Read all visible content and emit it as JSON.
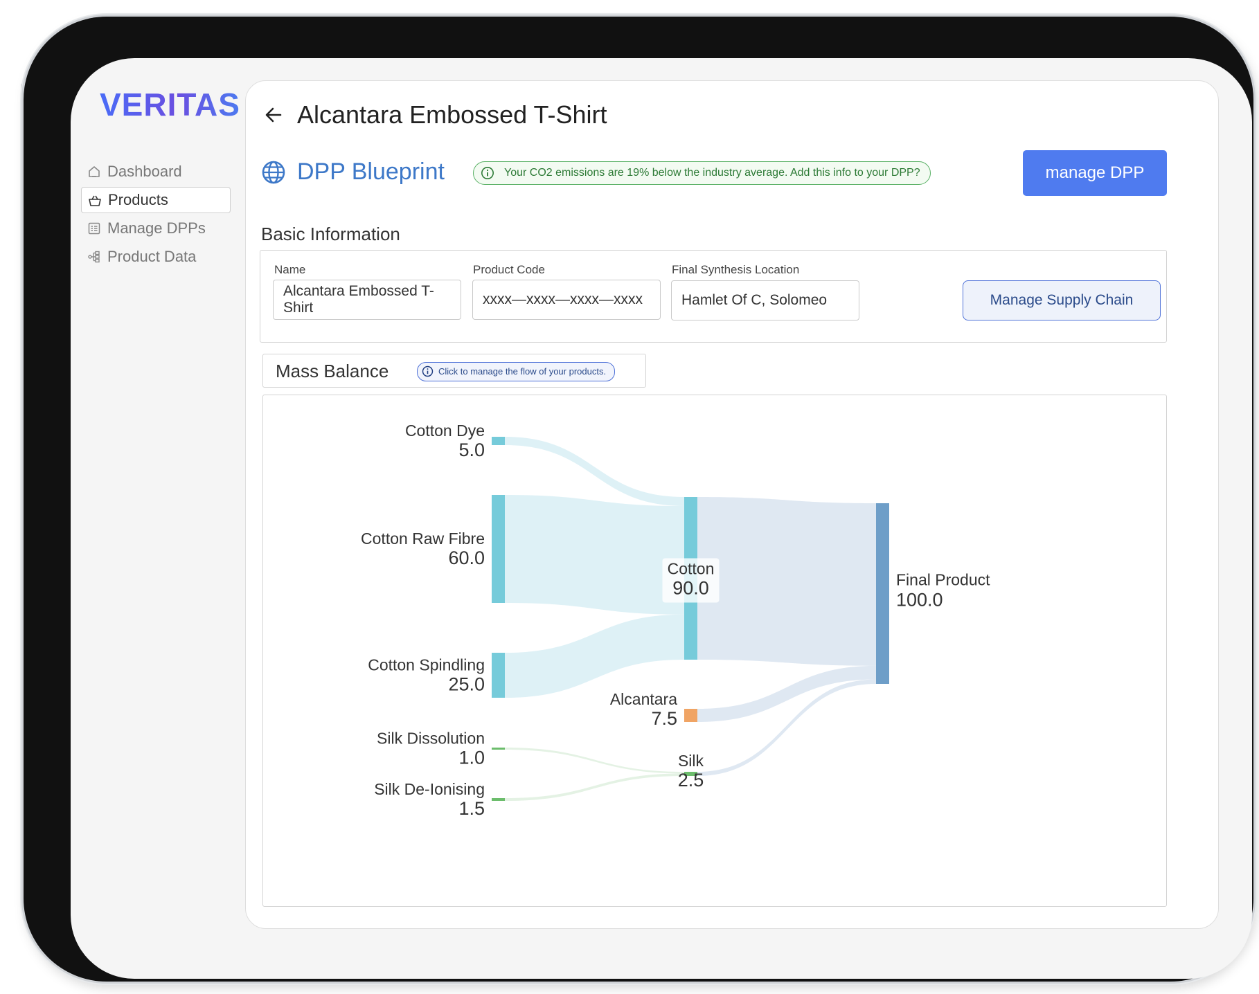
{
  "app": {
    "logo": "VERITAS"
  },
  "sidebar": {
    "items": [
      {
        "label": "Dashboard",
        "icon": "home-icon",
        "active": false
      },
      {
        "label": "Products",
        "icon": "basket-icon",
        "active": true
      },
      {
        "label": "Manage DPPs",
        "icon": "document-list-icon",
        "active": false
      },
      {
        "label": "Product Data",
        "icon": "hierarchy-icon",
        "active": false
      }
    ]
  },
  "header": {
    "title": "Alcantara Embossed T-Shirt",
    "section_title": "DPP Blueprint",
    "notice": "Your CO2 emissions are 19% below the industry average. Add this info to your DPP?",
    "manage_button": "manage DPP"
  },
  "basic_info": {
    "heading": "Basic Information",
    "name_label": "Name",
    "name_value": "Alcantara Embossed T-Shirt",
    "code_label": "Product Code",
    "code_value": "xxxx—xxxx—xxxx—xxxx",
    "location_label": "Final Synthesis Location",
    "location_value": "Hamlet Of C, Solomeo",
    "supply_chain_button": "Manage Supply Chain"
  },
  "mass_balance": {
    "title": "Mass Balance",
    "info": "Click to manage the flow of your products."
  },
  "colors": {
    "accent": "#4f7bef",
    "dpp_title": "#3d78c8",
    "notice_green": "#2c7a35"
  },
  "chart_data": {
    "type": "sankey",
    "nodes": [
      {
        "id": "cotton_dye",
        "label": "Cotton Dye",
        "value": "5.0",
        "color": "#76cbda"
      },
      {
        "id": "cotton_raw",
        "label": "Cotton Raw Fibre",
        "value": "60.0",
        "color": "#76cbda"
      },
      {
        "id": "cotton_spindling",
        "label": "Cotton Spindling",
        "value": "25.0",
        "color": "#76cbda"
      },
      {
        "id": "silk_dissolution",
        "label": "Silk Dissolution",
        "value": "1.0",
        "color": "#6cbd6c"
      },
      {
        "id": "silk_deionising",
        "label": "Silk De-Ionising",
        "value": "1.5",
        "color": "#6cbd6c"
      },
      {
        "id": "cotton",
        "label": "Cotton",
        "value": "90.0",
        "color": "#76cbda"
      },
      {
        "id": "alcantara",
        "label": "Alcantara",
        "value": "7.5",
        "color": "#f0a464"
      },
      {
        "id": "silk",
        "label": "Silk",
        "value": "2.5",
        "color": "#6cbd6c"
      },
      {
        "id": "final",
        "label": "Final Product",
        "value": "100.0",
        "color": "#6e9ec8"
      }
    ],
    "links": [
      {
        "source": "cotton_dye",
        "target": "cotton",
        "value": 5.0
      },
      {
        "source": "cotton_raw",
        "target": "cotton",
        "value": 60.0
      },
      {
        "source": "cotton_spindling",
        "target": "cotton",
        "value": 25.0
      },
      {
        "source": "silk_dissolution",
        "target": "silk",
        "value": 1.0
      },
      {
        "source": "silk_deionising",
        "target": "silk",
        "value": 1.5
      },
      {
        "source": "cotton",
        "target": "final",
        "value": 90.0
      },
      {
        "source": "alcantara",
        "target": "final",
        "value": 7.5
      },
      {
        "source": "silk",
        "target": "final",
        "value": 2.5
      }
    ]
  }
}
